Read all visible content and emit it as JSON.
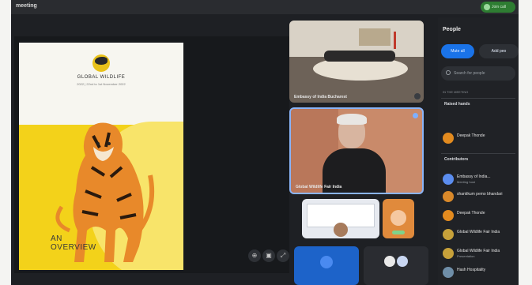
{
  "app": {
    "title": "meeting",
    "top_button": "Join call"
  },
  "presentation": {
    "brand": "GLOBAL WILDLIFE",
    "subtitle": "2022 | 22nd to 1st November 2022",
    "overview_line1": "AN",
    "overview_line2": "OVERVIEW",
    "controls": [
      "⊕",
      "▣",
      "⤢"
    ]
  },
  "tiles": {
    "embassy": "Embassy of India Bucharest",
    "global": "Global Wildlife Fair India"
  },
  "panel": {
    "title": "People",
    "mute_all": "Mute all",
    "add_people": "Add peo",
    "search_placeholder": "Search for people",
    "section_in_call": "IN THE MEETING",
    "group_raised": "Raised hands",
    "group_contributors": "Contributors",
    "raised_person": "Deepak Thonde",
    "contributors": [
      {
        "name": "Embassy of India...",
        "role": "Meeting host",
        "color": "#5b8def"
      },
      {
        "name": "shantikum pemo bhandari",
        "role": "",
        "color": "#d9892a"
      },
      {
        "name": "Deepak Thonde",
        "role": "",
        "color": "#e38b1f"
      },
      {
        "name": "Global Wildlife Fair India",
        "role": "",
        "color": "#c7a13a"
      },
      {
        "name": "Global Wildlife Fair India",
        "role": "Presentation",
        "color": "#c7a13a"
      },
      {
        "name": "Hash Hospitality",
        "role": "",
        "color": "#6f8ea8"
      }
    ]
  }
}
